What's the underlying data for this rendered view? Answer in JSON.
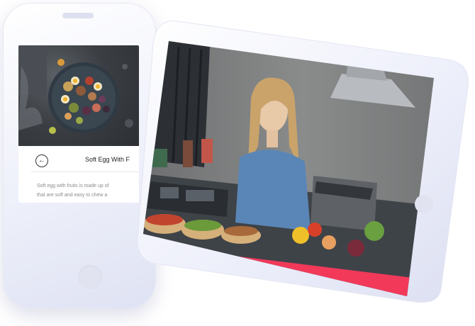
{
  "phone": {
    "card_title": "Soft Egg With F",
    "description_lines": [
      "Soft egg with fruits is made up of",
      "that are soft and easy to chew a"
    ],
    "icons": {
      "back": "arrow-left-icon",
      "home": "home-button-icon"
    }
  },
  "tablet": {
    "content": "cooking-video-frame",
    "icons": {
      "home": "home-button-icon"
    }
  },
  "colors": {
    "device_body": "#eef0fa",
    "accent_bar": "#f2395a",
    "text_dark": "#222222",
    "text_muted": "#8a8a8a"
  }
}
